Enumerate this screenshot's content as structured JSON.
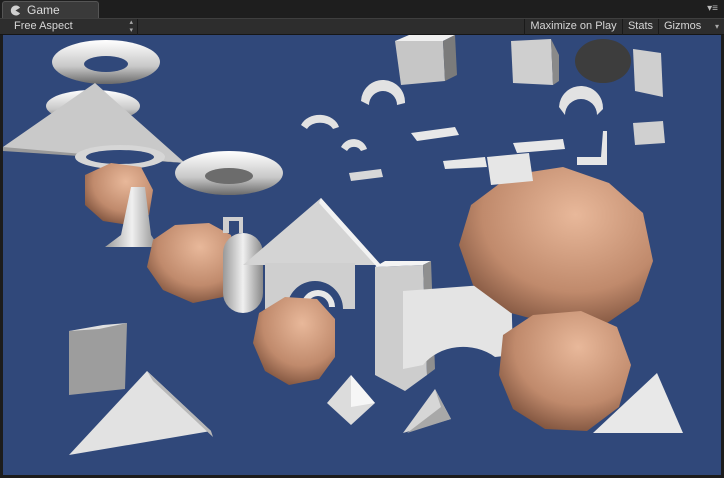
{
  "window": {
    "tab_label": "Game",
    "tab_icon": "pacman-icon",
    "panel_menu_icon": "panel-menu-icon"
  },
  "toolbar": {
    "aspect_label": "Free Aspect",
    "maximize_label": "Maximize on Play",
    "stats_label": "Stats",
    "gizmos_label": "Gizmos"
  },
  "viewport": {
    "background_color": "#30487a",
    "object_color": "#e6e6e6",
    "rock_color": "#d4a184"
  }
}
